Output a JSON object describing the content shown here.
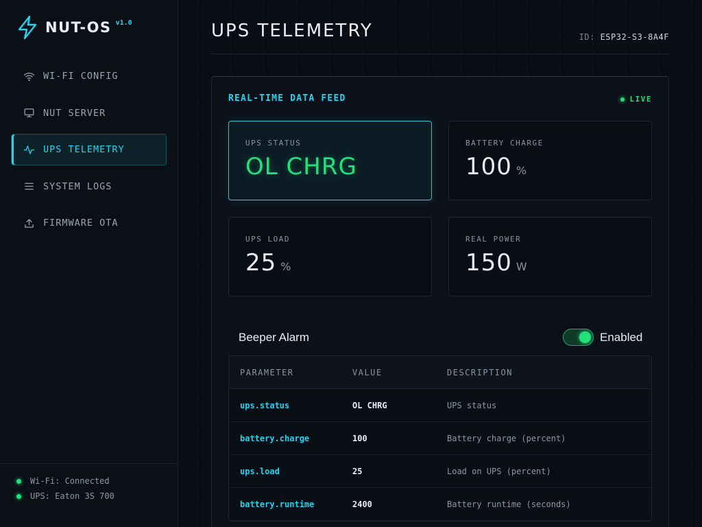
{
  "brand": {
    "name": "NUT-OS",
    "version": "v1.0"
  },
  "nav": [
    {
      "label": "WI-FI CONFIG",
      "icon": "wifi-icon"
    },
    {
      "label": "NUT SERVER",
      "icon": "monitor-icon"
    },
    {
      "label": "UPS TELEMETRY",
      "icon": "activity-icon"
    },
    {
      "label": "SYSTEM LOGS",
      "icon": "list-icon"
    },
    {
      "label": "FIRMWARE OTA",
      "icon": "upload-icon"
    }
  ],
  "footer": {
    "wifi": "Wi-Fi: Connected",
    "ups": "UPS: Eaton 3S 700"
  },
  "header": {
    "title": "UPS TELEMETRY",
    "id_label": "ID:",
    "id_value": "ESP32-S3-8A4F"
  },
  "panel": {
    "title": "REAL-TIME DATA FEED",
    "live": "LIVE"
  },
  "cards": [
    {
      "label": "UPS STATUS",
      "value": "OL CHRG",
      "unit": ""
    },
    {
      "label": "BATTERY CHARGE",
      "value": "100",
      "unit": "%"
    },
    {
      "label": "UPS LOAD",
      "value": "25",
      "unit": "%"
    },
    {
      "label": "REAL POWER",
      "value": "150",
      "unit": "W"
    }
  ],
  "beeper": {
    "label": "Beeper Alarm",
    "state": "Enabled"
  },
  "table": {
    "headers": [
      "PARAMETER",
      "VALUE",
      "DESCRIPTION"
    ],
    "rows": [
      [
        "ups.status",
        "OL CHRG",
        "UPS status"
      ],
      [
        "battery.charge",
        "100",
        "Battery charge (percent)"
      ],
      [
        "ups.load",
        "25",
        "Load on UPS (percent)"
      ],
      [
        "battery.runtime",
        "2400",
        "Battery runtime (seconds)"
      ]
    ]
  },
  "colors": {
    "accent": "#22d3ee",
    "ok": "#22e07a",
    "background": "#0a0d13"
  }
}
